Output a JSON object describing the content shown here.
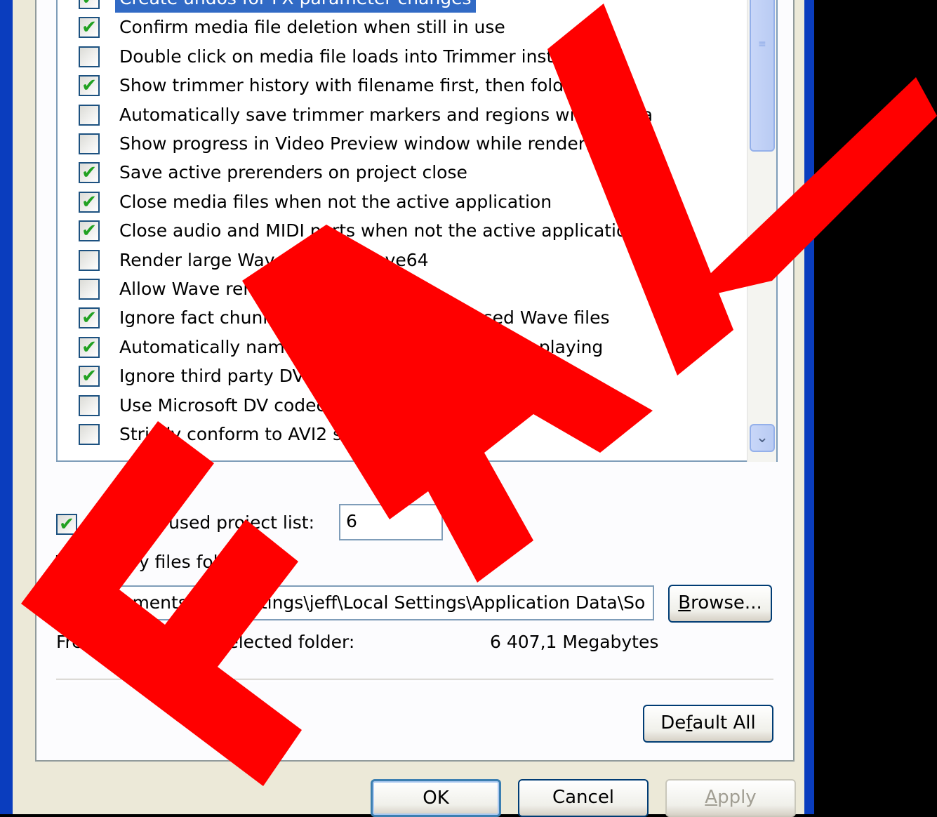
{
  "options": [
    {
      "label": "Create undos for FX parameter changes",
      "checked": true,
      "selected": true
    },
    {
      "label": "Confirm media file deletion when still in use",
      "checked": true
    },
    {
      "label": "Double click on media file loads into Trimmer instead of",
      "checked": false
    },
    {
      "label": "Show trimmer history with filename first, then folder",
      "checked": true
    },
    {
      "label": "Automatically save trimmer markers and regions with media",
      "checked": false
    },
    {
      "label": "Show progress in Video Preview window while rendering",
      "checked": false
    },
    {
      "label": "Save active prerenders on project close",
      "checked": true
    },
    {
      "label": "Close media files when not the active application",
      "checked": true
    },
    {
      "label": "Close audio and MIDI ports when not the active application",
      "checked": true
    },
    {
      "label": "Render large Wave files as Wave64",
      "checked": false
    },
    {
      "label": "Allow Wave renders",
      "checked": false
    },
    {
      "label": "Ignore fact chunk when opening compressed Wave files",
      "checked": true
    },
    {
      "label": "Automatically name regions and markers while playing",
      "checked": true
    },
    {
      "label": "Ignore third party DV codecs",
      "checked": true
    },
    {
      "label": "Use Microsoft DV codec",
      "checked": false
    },
    {
      "label": "Strictly conform to AVI2 specification",
      "checked": false
    }
  ],
  "recent": {
    "checked": true,
    "label": "Recently used project list:",
    "value": "6"
  },
  "temp": {
    "label": "Temporary files folder:",
    "path": "C:\\Documents and Settings\\jeff\\Local Settings\\Application Data\\So",
    "browse_prefix": "B",
    "browse_rest": "rowse...",
    "free_label": "Free disk space in selected folder:",
    "free_value": "6 407,1 Megabytes"
  },
  "buttons": {
    "default_all_a": "De",
    "default_all_u": "f",
    "default_all_b": "ault All",
    "ok": "OK",
    "cancel": "Cancel",
    "apply_u": "A",
    "apply_rest": "pply"
  },
  "overlay": {
    "text": "FAIL",
    "color": "#FF0000"
  },
  "icons": {
    "check": "✔",
    "scroll_down": "chevron-down-icon",
    "grip": "scroll-grip-icon"
  }
}
